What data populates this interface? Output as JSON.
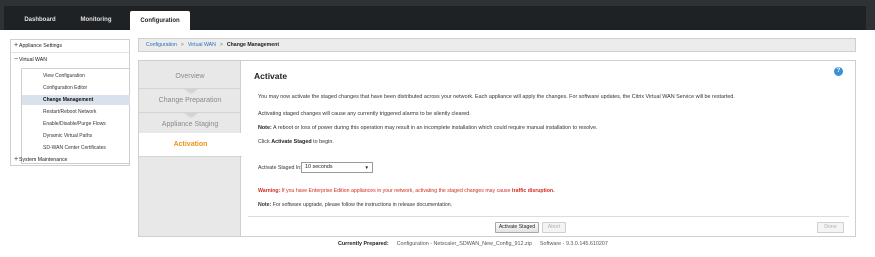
{
  "top_nav": {
    "tabs": [
      {
        "label": "Dashboard"
      },
      {
        "label": "Monitoring"
      },
      {
        "label": "Configuration"
      }
    ]
  },
  "tree": {
    "appliance_settings": "Appliance Settings",
    "virtual_wan": "Virtual WAN",
    "virtual_wan_items": [
      "View Configuration",
      "Configuration Editor",
      "Change Management",
      "Restart/Reboot Network",
      "Enable/Disable/Purge Flows",
      "Dynamic Virtual Paths",
      "SD-WAN Center Certificates"
    ],
    "system_maintenance": "System Maintenance",
    "expand_plus": "+",
    "collapse_minus": "−"
  },
  "breadcrumb": {
    "items": [
      "Configuration",
      "Virtual WAN"
    ],
    "separator": ">",
    "current": "Change Management"
  },
  "steps": [
    "Overview",
    "Change Preparation",
    "Appliance Staging",
    "Activation"
  ],
  "activate": {
    "title": "Activate",
    "help_glyph": "?",
    "para1": "You may now activate the staged changes that have been distributed across your network. Each appliance will apply the changes. For software updates, the Citrix Virtual WAN Service will be restarted.",
    "para2": "Activating staged changes will cause any currently triggered alarms to be silently cleared.",
    "note_label": "Note:",
    "note_text": " A reboot or loss of power during this operation may result in an incomplete installation which could require manual installation to resolve.",
    "click_prefix": "Click ",
    "click_bold": "Activate Staged",
    "click_suffix": " to begin.",
    "stage_label": "Activate Staged In:",
    "stage_value": "10 seconds",
    "caret": "▼",
    "warn_label": "Warning:",
    "warn_text": " If you have Enterprise Edition appliances in your network, activating the staged changes may cause ",
    "warn_bold": "traffic disruption.",
    "note2_label": "Note:",
    "note2_text": " For software upgrade, please follow the instructions in release documentation.",
    "buttons": {
      "activate_staged": "Activate Staged",
      "abort": "Abort",
      "done": "Done"
    }
  },
  "footer": {
    "label": "Currently Prepared:",
    "config": "Configuration - Netscaler_SDWAN_New_Config_912.zip",
    "software": "Software - 9.3.0.145.610207"
  },
  "colors": {
    "accent_orange": "#e8951d",
    "link_blue": "#2a6ebb",
    "warning_red": "#d52b1e",
    "topbar": "#1f2225"
  }
}
